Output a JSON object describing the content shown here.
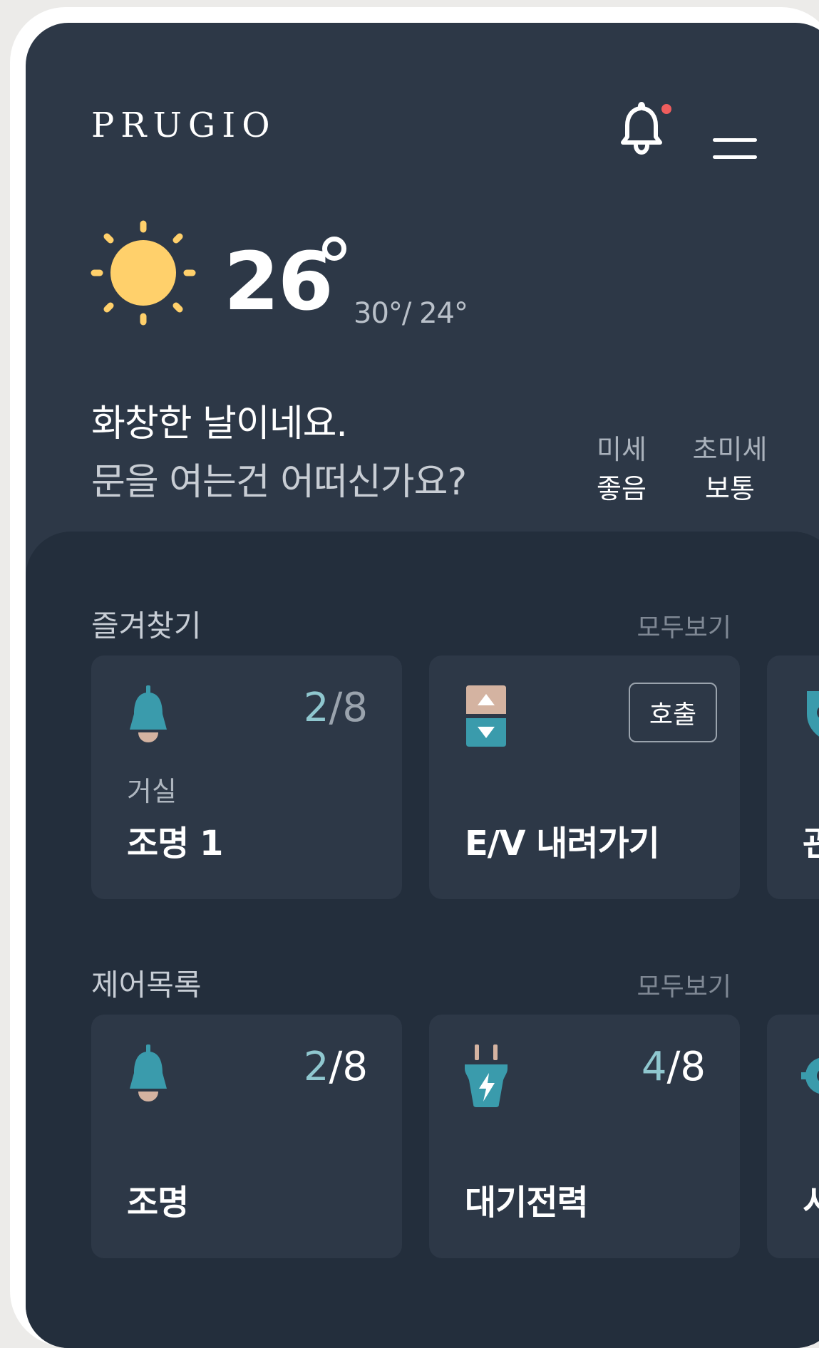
{
  "header": {
    "logo": "PRUGIO",
    "bell_icon": "bell-icon",
    "menu_icon": "hamburger-menu-icon",
    "has_notification": true
  },
  "weather": {
    "icon": "sun-icon",
    "temp": "26",
    "high_low": "30°/ 24°",
    "message_line1": "화창한 날이네요.",
    "message_line2": "문을 여는건 어떠신가요?",
    "fine_dust": {
      "label": "미세",
      "value": "좋음"
    },
    "ultrafine_dust": {
      "label": "초미세",
      "value": "보통"
    }
  },
  "favorites": {
    "title": "즐겨찾기",
    "view_all": "모두보기",
    "cards": [
      {
        "icon": "lamp-icon",
        "count_on": "2",
        "count_total": "/8",
        "room": "거실",
        "name": "조명 1"
      },
      {
        "icon": "elevator-icon",
        "button": "호출",
        "name": "E/V 내려가기"
      },
      {
        "icon": "shield-icon",
        "name": "관"
      }
    ]
  },
  "controls": {
    "title": "제어목록",
    "view_all": "모두보기",
    "cards": [
      {
        "icon": "lamp-icon",
        "count_on": "2",
        "count_total": "/8",
        "name": "조명"
      },
      {
        "icon": "plug-icon",
        "count_on": "4",
        "count_total": "/8",
        "name": "대기전력"
      },
      {
        "icon": "gear-icon",
        "name": "시"
      }
    ]
  },
  "colors": {
    "accent": "#3a9bac",
    "highlight": "#8fc7cf",
    "sun": "#ffd06b",
    "lamp_base": "#d4b3a1",
    "alert": "#ef5d5d"
  }
}
